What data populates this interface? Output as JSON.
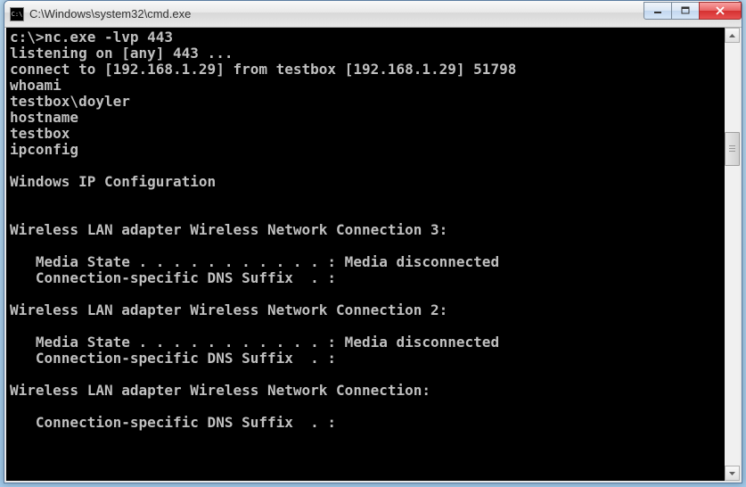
{
  "window": {
    "title": "C:\\Windows\\system32\\cmd.exe"
  },
  "terminal": {
    "lines": [
      "c:\\>nc.exe -lvp 443",
      "listening on [any] 443 ...",
      "connect to [192.168.1.29] from testbox [192.168.1.29] 51798",
      "whoami",
      "testbox\\doyler",
      "hostname",
      "testbox",
      "ipconfig",
      "",
      "Windows IP Configuration",
      "",
      "",
      "Wireless LAN adapter Wireless Network Connection 3:",
      "",
      "   Media State . . . . . . . . . . . : Media disconnected",
      "   Connection-specific DNS Suffix  . :",
      "",
      "Wireless LAN adapter Wireless Network Connection 2:",
      "",
      "   Media State . . . . . . . . . . . : Media disconnected",
      "   Connection-specific DNS Suffix  . :",
      "",
      "Wireless LAN adapter Wireless Network Connection:",
      "",
      "   Connection-specific DNS Suffix  . :"
    ]
  }
}
